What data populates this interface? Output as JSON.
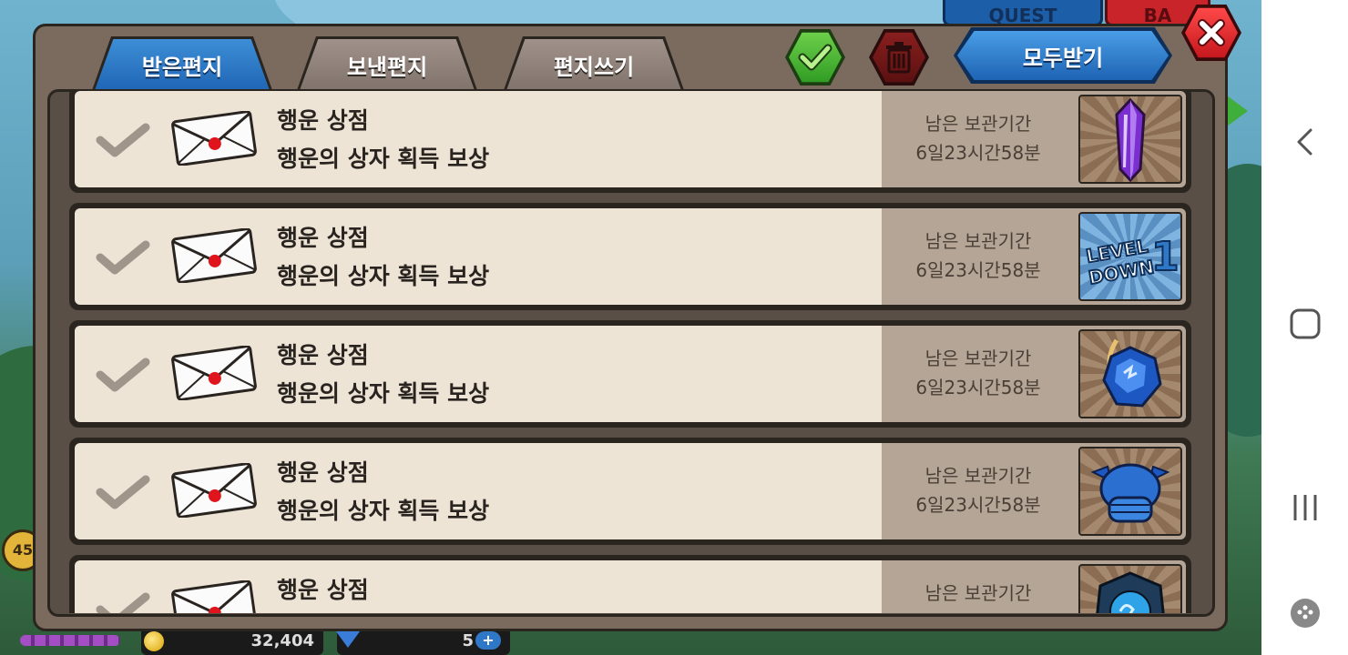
{
  "background": {
    "quest_label": "QUEST",
    "battle_label": "BA",
    "gold_amount": "32,404",
    "gem_amount": "5",
    "plus_label": "+",
    "player_level": "45"
  },
  "dialog": {
    "tabs": [
      {
        "label": "받은편지",
        "active": true
      },
      {
        "label": "보낸편지",
        "active": false
      },
      {
        "label": "편지쓰기",
        "active": false
      }
    ],
    "receive_all_label": "모두받기",
    "select_all_icon": "green-check-icon",
    "delete_icon": "trash-icon",
    "close_icon": "close-icon"
  },
  "mails": [
    {
      "sender": "행운 상점",
      "subject": "행운의 상자 획득 보상",
      "remain_label": "남은 보관기간",
      "remain_value": "6일23시간58분",
      "item_icon": "purple-crystal-icon"
    },
    {
      "sender": "행운 상점",
      "subject": "행운의 상자 획득 보상",
      "remain_label": "남은 보관기간",
      "remain_value": "6일23시간58분",
      "item_icon": "level-down-1-icon",
      "item_text": "LEVEL DOWN 1"
    },
    {
      "sender": "행운 상점",
      "subject": "행운의 상자 획득 보상",
      "remain_label": "남은 보관기간",
      "remain_value": "6일23시간58분",
      "item_icon": "blue-gem-bow-icon"
    },
    {
      "sender": "행운 상점",
      "subject": "행운의 상자 획득 보상",
      "remain_label": "남은 보관기간",
      "remain_value": "6일23시간58분",
      "item_icon": "blue-helmet-icon"
    },
    {
      "sender": "행운 상점",
      "subject": "",
      "remain_label": "남은 보관기간",
      "remain_value": "",
      "item_icon": "blue-orb-shield-icon"
    }
  ],
  "colors": {
    "tab_active": "#1e64b4",
    "row_bg": "#ede4d6",
    "side_bg": "#b5a596",
    "accent_red": "#c4161c",
    "accent_green": "#2f9b23"
  }
}
